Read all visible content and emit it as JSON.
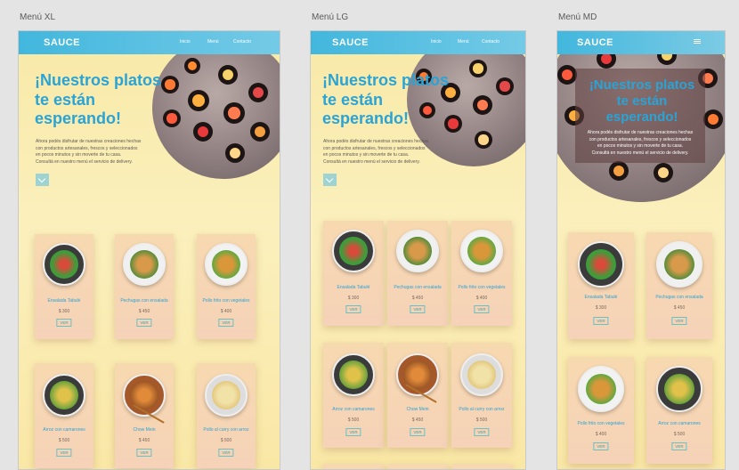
{
  "frames": [
    {
      "label": "Menú XL"
    },
    {
      "label": "Menú LG"
    },
    {
      "label": "Menú MD"
    }
  ],
  "nav": {
    "logo": "SAUCE",
    "links": [
      "Inicio",
      "Menú",
      "Contacto"
    ]
  },
  "hero": {
    "title_lines": [
      "¡Nuestros platos",
      "te están",
      "esperando!"
    ],
    "text_lines_wide": [
      "Ahora podés disfrutar de nuestras creaciones hechas",
      "con productos artesanales, frescos y seleccionados",
      "en pocos minutos y sin moverte de tu casa.",
      "Consultá en nuestro menú el servicio de delivery."
    ],
    "text_lines_narrow": [
      "Ahora podés disfrutar de nuestras creaciones hechas",
      "con productos artesanales, frescos y seleccionados",
      "en pocos minutos y sin moverte de tu casa.",
      "Consultá en nuestro menú el servicio de delivery."
    ]
  },
  "dishes": [
    {
      "name": "Ensalada Tabulé",
      "price": "$ 300",
      "button": "VER"
    },
    {
      "name": "Pechugas con ensalada",
      "price": "$ 450",
      "button": "VER"
    },
    {
      "name": "Pollo frito con vegetales",
      "price": "$ 400",
      "button": "VER"
    },
    {
      "name": "Arroz con camarones",
      "price": "$ 500",
      "button": "VER"
    },
    {
      "name": "Chow Mein",
      "price": "$ 450",
      "button": "VER"
    },
    {
      "name": "Pollo al curry con arroz",
      "price": "$ 500",
      "button": "VER"
    }
  ],
  "colors": {
    "accent": "#2aa3d6",
    "nav": "#42b7dd",
    "button": "#9fd3d2",
    "background": "#f8e9a6"
  }
}
